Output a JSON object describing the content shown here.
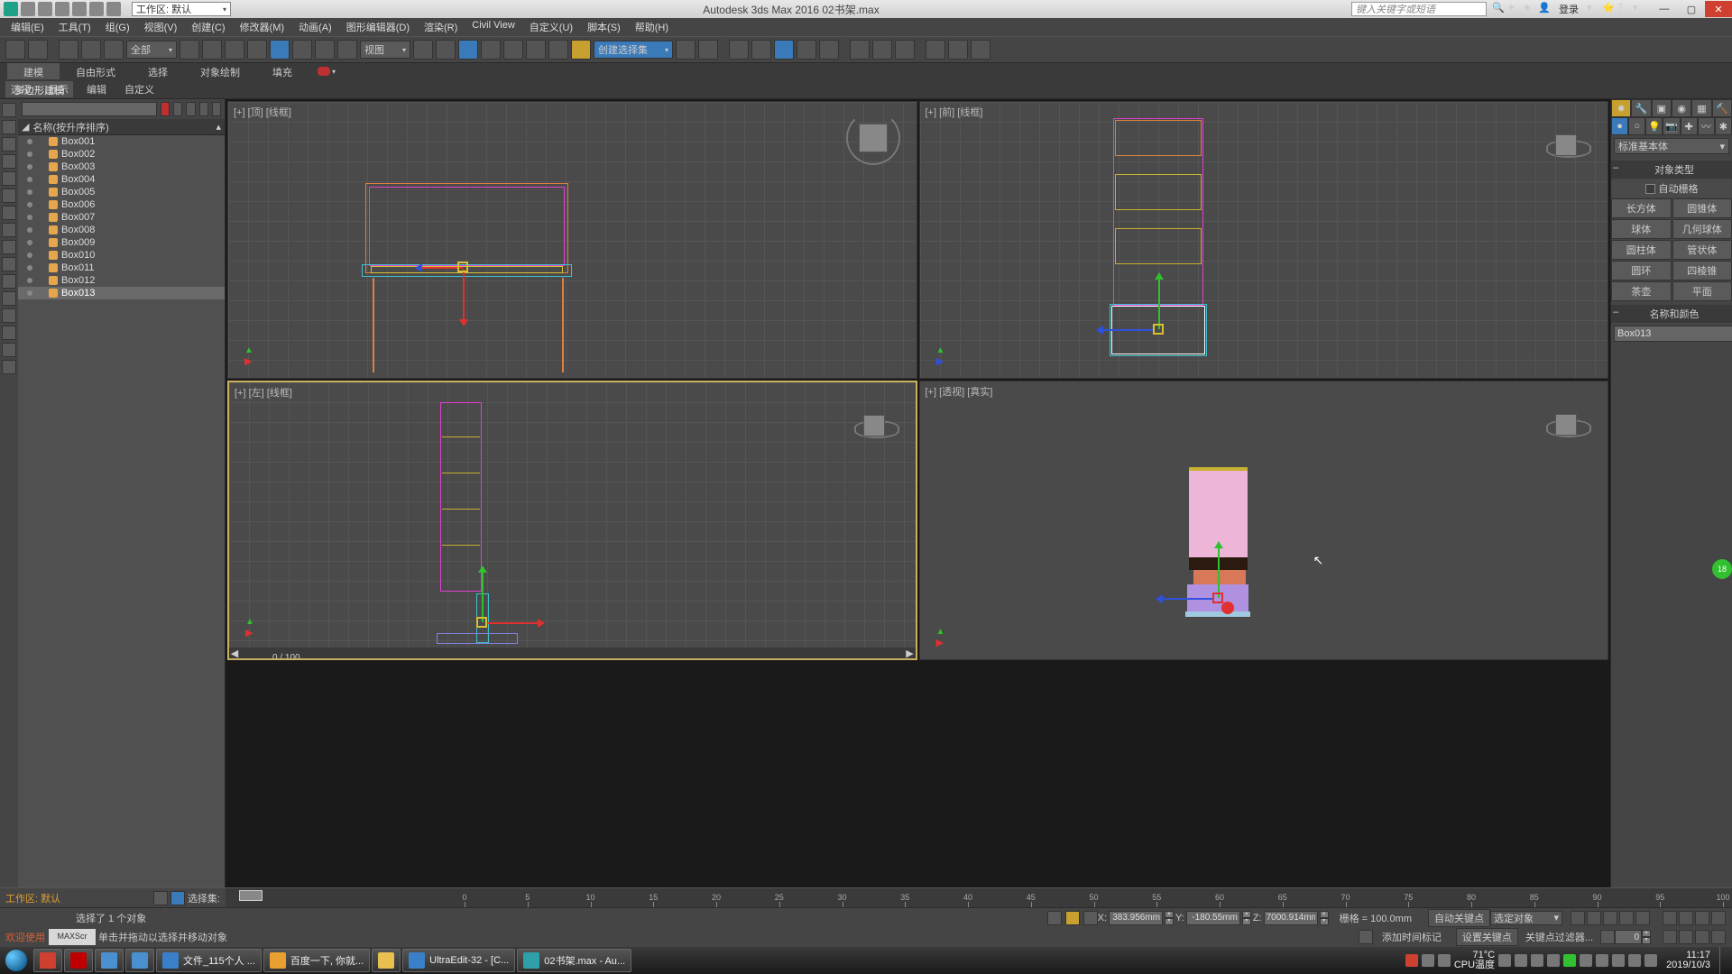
{
  "title": "Autodesk 3ds Max 2016   02书架.max",
  "workspace_dd": "工作区: 默认",
  "search_placeholder": "键入关键字或短语",
  "login_text": "登录",
  "menus": [
    "编辑(E)",
    "工具(T)",
    "组(G)",
    "视图(V)",
    "创建(C)",
    "修改器(M)",
    "动画(A)",
    "图形编辑器(D)",
    "渲染(R)",
    "Civil View",
    "自定义(U)",
    "脚本(S)",
    "帮助(H)"
  ],
  "toolbar_dd1": "全部",
  "toolbar_dd2": "视图",
  "toolbar_dd3": "创建选择集",
  "ribbon_tabs": [
    "建模",
    "自由形式",
    "选择",
    "对象绘制",
    "填充"
  ],
  "ribbon_active": "建模",
  "ribbon_sub": "多边形建模",
  "ribbon_row2": [
    "选择",
    "显示",
    "编辑",
    "自定义"
  ],
  "scene_header": "名称(按升序排序)",
  "scene_items": [
    "Box001",
    "Box002",
    "Box003",
    "Box004",
    "Box005",
    "Box006",
    "Box007",
    "Box008",
    "Box009",
    "Box010",
    "Box011",
    "Box012",
    "Box013"
  ],
  "scene_selected_idx": 12,
  "vp_labels": [
    "[+] [顶] [线框]",
    "[+] [前] [线框]",
    "[+] [左] [线框]",
    "[+] [透视] [真实]"
  ],
  "frame_counter": "0 / 100",
  "workspace_status": "工作区: 默认",
  "selection_set_label": "选择集:",
  "status_selected": "选择了 1 个对象",
  "status_welcome": "欢迎使用",
  "maxscript": "MAXScr",
  "status_hint": "单击并拖动以选择并移动对象",
  "coords": {
    "x": "383.956mm",
    "y": "-180.55mm",
    "z": "7000.914mm"
  },
  "grid_label": "栅格 = 100.0mm",
  "add_time_tag": "添加时间标记",
  "autokey": "自动关键点",
  "setkey": "设置关键点",
  "key_dd": "选定对象",
  "key_filter": "关键点过滤器...",
  "cmd_dd": "标准基本体",
  "cmd_section1": "对象类型",
  "cmd_autogrid": "自动栅格",
  "cmd_prims": [
    [
      "长方体",
      "圆锥体"
    ],
    [
      "球体",
      "几何球体"
    ],
    [
      "圆柱体",
      "管状体"
    ],
    [
      "圆环",
      "四棱锥"
    ],
    [
      "茶壶",
      "平面"
    ]
  ],
  "cmd_section2": "名称和颜色",
  "cmd_name": "Box013",
  "timeline_ticks": [
    0,
    5,
    10,
    15,
    20,
    25,
    30,
    35,
    40,
    45,
    50,
    55,
    60,
    65,
    70,
    75,
    80,
    85,
    90,
    95,
    100
  ],
  "taskbar_items": [
    {
      "label": "",
      "color": "#d04030"
    },
    {
      "label": "",
      "color": "#c00000"
    },
    {
      "label": "",
      "color": "#4a90d0"
    },
    {
      "label": "",
      "color": "#4a90d0"
    },
    {
      "label": "文件_115个人 ...",
      "color": "#3a80c8"
    },
    {
      "label": "百度一下, 你就...",
      "color": "#e8a030"
    },
    {
      "label": "",
      "color": "#e8c050"
    },
    {
      "label": "UltraEdit-32 - [C...",
      "color": "#3a80c8"
    },
    {
      "label": "02书架.max - Au...",
      "color": "#30a0a8"
    }
  ],
  "weather": {
    "temp": "71°C",
    "label": "CPU温度"
  },
  "clock": {
    "time": "11:17",
    "date": "2019/10/3"
  },
  "badge": "18"
}
